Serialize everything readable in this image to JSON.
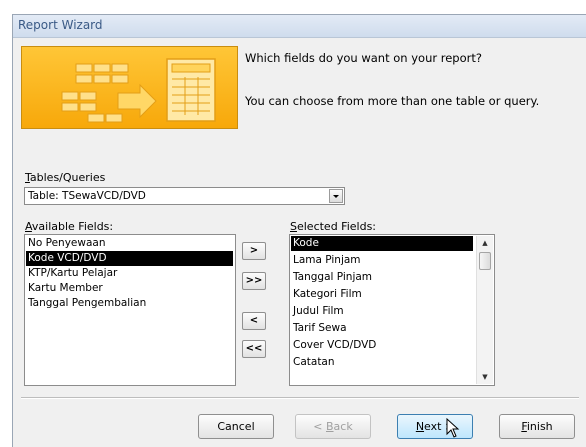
{
  "window": {
    "title": "Report Wizard"
  },
  "intro": {
    "question": "Which fields do you want on your report?",
    "hint": "You can choose from more than one table or query."
  },
  "tables_queries": {
    "label": "Tables/Queries",
    "label_mnemonic": "T",
    "label_rest": "ables/Queries",
    "selected": "Table: TSewaVCD/DVD"
  },
  "available_fields": {
    "label_mnemonic": "A",
    "label_rest": "vailable Fields:",
    "items": [
      "No Penyewaan",
      "Kode VCD/DVD",
      "KTP/Kartu Pelajar",
      "Kartu Member",
      "Tanggal Pengembalian"
    ],
    "selected_index": 1
  },
  "selected_fields": {
    "label_mnemonic": "S",
    "label_rest": "elected Fields:",
    "items": [
      "Kode",
      "Lama Pinjam",
      "Tanggal Pinjam",
      "Kategori Film",
      "Judul Film",
      "Tarif Sewa",
      "Cover VCD/DVD",
      "Catatan"
    ],
    "selected_index": 0
  },
  "move_buttons": {
    "add_one": ">",
    "add_all": ">>",
    "remove_one": "<",
    "remove_all": "<<"
  },
  "buttons": {
    "cancel": "Cancel",
    "back_mnemonic": "B",
    "back_prefix": "< ",
    "back_rest": "ack",
    "next_mnemonic": "N",
    "next_rest": "ext >",
    "finish_mnemonic": "F",
    "finish_rest": "inish"
  },
  "colors": {
    "banner": "#f7a80a",
    "title_text": "#3a5a86",
    "selection": "#000000"
  }
}
